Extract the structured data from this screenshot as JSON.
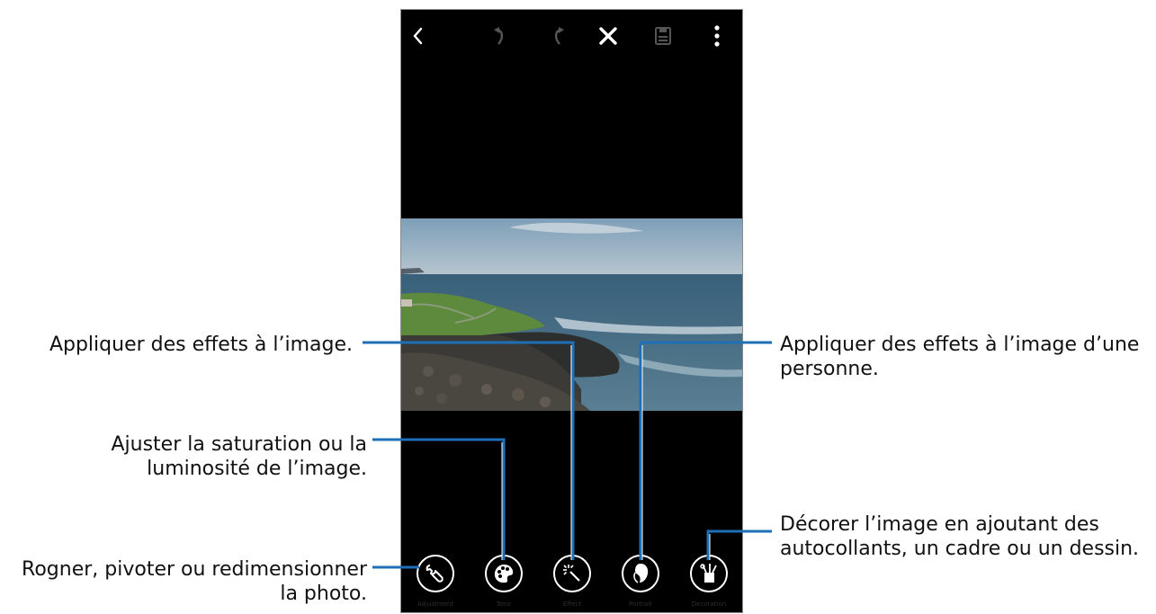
{
  "callouts": {
    "effects": "Appliquer des effets à l’image.",
    "adjust_line1": "Ajuster la saturation ou la",
    "adjust_line2": "luminosité de l’image.",
    "transform_line1": "Rogner, pivoter ou redimensionner",
    "transform_line2": "la photo.",
    "portrait_line1": "Appliquer des effets à l’image d’une",
    "portrait_line2": "personne.",
    "decorate_line1": "Décorer l’image en ajoutant des",
    "decorate_line2": "autocollants, un cadre ou un dessin."
  },
  "topbar": {
    "icons": [
      "back-icon",
      "undo-icon",
      "redo-icon",
      "close-icon",
      "save-icon",
      "more-icon"
    ]
  },
  "toolbar": {
    "tools": [
      {
        "name": "adjustment",
        "label": "Adjustment",
        "icon": "wrench-icon"
      },
      {
        "name": "tone",
        "label": "Tone",
        "icon": "palette-icon"
      },
      {
        "name": "effect",
        "label": "Effect",
        "icon": "magic-wand-icon"
      },
      {
        "name": "portrait",
        "label": "Portrait",
        "icon": "portrait-icon"
      },
      {
        "name": "decoration",
        "label": "Decoration",
        "icon": "brush-cup-icon"
      }
    ]
  },
  "colors": {
    "screen_bg": "#000000",
    "callout_line": "#1e6fb5",
    "icon_white": "#ffffff",
    "disabled_icon": "#555555"
  }
}
